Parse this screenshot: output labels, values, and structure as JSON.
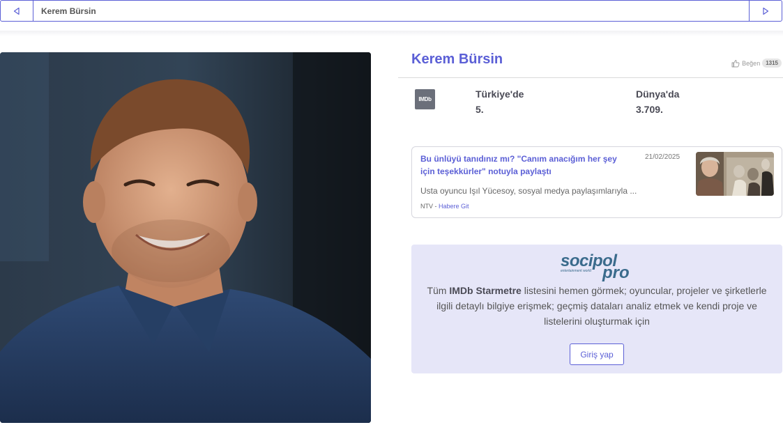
{
  "header": {
    "title": "Kerem Bürsin",
    "prev_icon": "triangle-left-icon",
    "next_icon": "triangle-right-icon"
  },
  "person": {
    "name": "Kerem Bürsin",
    "photo": "portrait-photo"
  },
  "like": {
    "icon": "thumbs-up-icon",
    "label": "Beğen",
    "count": "1315"
  },
  "imdb": {
    "badge": "IMDb",
    "turkey_label": "Türkiye'de",
    "turkey_rank": "5.",
    "world_label": "Dünya'da",
    "world_rank": "3.709."
  },
  "news": {
    "title": "Bu ünlüyü tanıdınız mı? \"Canım anacığım her şey için teşekkürler\" notuyla paylaştı",
    "date": "21/02/2025",
    "excerpt": "Usta oyuncu Işıl Yücesoy, sosyal medya paylaşımlarıyla ...",
    "source": "NTV",
    "separator": " - ",
    "link_label": "Habere Git",
    "thumbnail": "news-thumbnail-photo"
  },
  "promo": {
    "logo_main": "socipol",
    "logo_pro": "pro",
    "logo_tagline": "entertainment world",
    "text_prefix": "Tüm ",
    "text_bold": "IMDb Starmetre",
    "text_suffix": " listesini hemen görmek; oyuncular, projeler ve şirketlerle ilgili detaylı bilgiye erişmek; geçmiş dataları analiz etmek ve kendi proje ve listelerini oluşturmak için",
    "button_label": "Giriş yap"
  },
  "colors": {
    "accent": "#5b5fd6",
    "promo_bg": "#e6e6f8",
    "imdb_badge": "#6b6f7a",
    "logo": "#3a6b8c"
  }
}
